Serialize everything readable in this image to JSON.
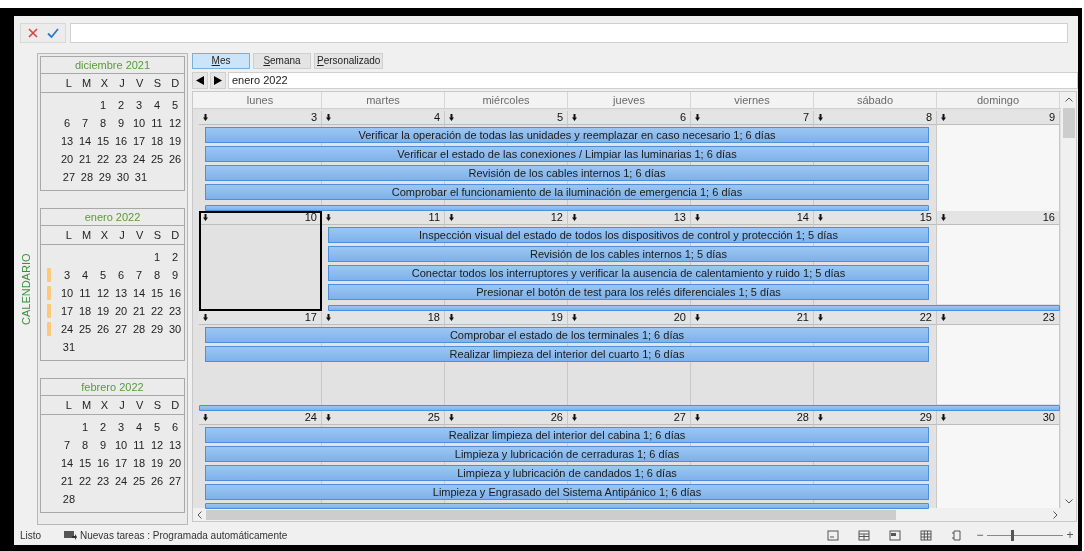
{
  "toolbar": {
    "buttons": [
      {
        "kind": "cancel"
      },
      {
        "kind": "confirm"
      }
    ]
  },
  "side_label": "CALENDARIO",
  "mini_calendars": [
    {
      "title": "diciembre 2021",
      "weekdays": [
        "L",
        "M",
        "X",
        "J",
        "V",
        "S",
        "D"
      ],
      "weeks": [
        {
          "kind": "first",
          "marked": false,
          "days": [
            "1",
            "2",
            "3",
            "4",
            "5"
          ]
        },
        {
          "kind": "full",
          "marked": false,
          "days": [
            "6",
            "7",
            "8",
            "9",
            "10",
            "11",
            "12"
          ]
        },
        {
          "kind": "full",
          "marked": false,
          "days": [
            "13",
            "14",
            "15",
            "16",
            "17",
            "18",
            "19"
          ]
        },
        {
          "kind": "full",
          "marked": false,
          "days": [
            "20",
            "21",
            "22",
            "23",
            "24",
            "25",
            "26"
          ]
        },
        {
          "kind": "last",
          "marked": false,
          "days": [
            "27",
            "28",
            "29",
            "30",
            "31"
          ]
        }
      ]
    },
    {
      "title": "enero 2022",
      "weekdays": [
        "L",
        "M",
        "X",
        "J",
        "V",
        "S",
        "D"
      ],
      "weeks": [
        {
          "kind": "first",
          "marked": false,
          "days": [
            "1",
            "2"
          ]
        },
        {
          "kind": "full",
          "marked": true,
          "days": [
            "3",
            "4",
            "5",
            "6",
            "7",
            "8",
            "9"
          ]
        },
        {
          "kind": "full",
          "marked": true,
          "days": [
            "10",
            "11",
            "12",
            "13",
            "14",
            "15",
            "16"
          ]
        },
        {
          "kind": "full",
          "marked": true,
          "days": [
            "17",
            "18",
            "19",
            "20",
            "21",
            "22",
            "23"
          ]
        },
        {
          "kind": "full",
          "marked": true,
          "days": [
            "24",
            "25",
            "26",
            "27",
            "28",
            "29",
            "30"
          ]
        },
        {
          "kind": "last",
          "marked": false,
          "days": [
            "31"
          ]
        }
      ]
    },
    {
      "title": "febrero 2022",
      "weekdays": [
        "L",
        "M",
        "X",
        "J",
        "V",
        "S",
        "D"
      ],
      "weeks": [
        {
          "kind": "first",
          "marked": false,
          "days": [
            "1",
            "2",
            "3",
            "4",
            "5",
            "6"
          ]
        },
        {
          "kind": "full",
          "marked": false,
          "days": [
            "7",
            "8",
            "9",
            "10",
            "11",
            "12",
            "13"
          ]
        },
        {
          "kind": "full",
          "marked": false,
          "days": [
            "14",
            "15",
            "16",
            "17",
            "18",
            "19",
            "20"
          ]
        },
        {
          "kind": "full",
          "marked": false,
          "days": [
            "21",
            "22",
            "23",
            "24",
            "25",
            "26",
            "27"
          ]
        },
        {
          "kind": "last",
          "marked": false,
          "days": [
            "28"
          ]
        }
      ]
    }
  ],
  "view_tabs": [
    {
      "label": "Mes",
      "selected": true
    },
    {
      "label": "Semana",
      "selected": false
    },
    {
      "label": "Personalizado",
      "selected": false
    }
  ],
  "period": "enero 2022",
  "weekday_headers": [
    "lunes",
    "martes",
    "miércoles",
    "jueves",
    "viernes",
    "sábado",
    "domingo"
  ],
  "weeks": [
    {
      "days": [
        {
          "date": "3",
          "kind": "busy",
          "selected": false
        },
        {
          "date": "4",
          "kind": "busy",
          "selected": false
        },
        {
          "date": "5",
          "kind": "busy",
          "selected": false
        },
        {
          "date": "6",
          "kind": "busy",
          "selected": false
        },
        {
          "date": "7",
          "kind": "busy",
          "selected": false
        },
        {
          "date": "8",
          "kind": "busy",
          "selected": false
        },
        {
          "date": "9",
          "kind": "free",
          "selected": false
        }
      ],
      "tasks": [
        {
          "kind": "workweek",
          "label": "Verificar la operación de todas las unidades y reemplazar en caso necesario 1; 6 días"
        },
        {
          "kind": "workweek",
          "label": "Verificar el estado de las conexiones / Limpiar las luminarias 1; 6 días"
        },
        {
          "kind": "workweek",
          "label": "Revisión de los cables internos 1; 6 días"
        },
        {
          "kind": "workweek",
          "label": "Comprobar el funcionamiento de la iluminación de emergencia 1; 6 días"
        },
        {
          "kind": "workweek"
        }
      ]
    },
    {
      "days": [
        {
          "date": "10",
          "kind": "busy",
          "selected": true
        },
        {
          "date": "11",
          "kind": "busy",
          "selected": false
        },
        {
          "date": "12",
          "kind": "busy",
          "selected": false
        },
        {
          "date": "13",
          "kind": "busy",
          "selected": false
        },
        {
          "date": "14",
          "kind": "busy",
          "selected": false
        },
        {
          "date": "15",
          "kind": "busy",
          "selected": false
        },
        {
          "date": "16",
          "kind": "free",
          "selected": false
        }
      ],
      "tasks": [
        {
          "kind": "midweek",
          "label": "Inspección visual del estado de todos los dispositivos de control y protección 1; 5 días"
        },
        {
          "kind": "midweek",
          "label": "Revisión de los cables internos 1; 5 días"
        },
        {
          "kind": "midweek",
          "label": "Conectar todos los interruptores y verificar la ausencia de calentamiento y ruido 1; 5 días"
        },
        {
          "kind": "midweek",
          "label": "Presionar el botón de test para los relés diferenciales 1; 5 días"
        },
        {
          "kind": "lateweek"
        }
      ]
    },
    {
      "days": [
        {
          "date": "17",
          "kind": "busy",
          "selected": false
        },
        {
          "date": "18",
          "kind": "busy",
          "selected": false
        },
        {
          "date": "19",
          "kind": "busy",
          "selected": false
        },
        {
          "date": "20",
          "kind": "busy",
          "selected": false
        },
        {
          "date": "21",
          "kind": "busy",
          "selected": false
        },
        {
          "date": "22",
          "kind": "busy",
          "selected": false
        },
        {
          "date": "23",
          "kind": "free",
          "selected": false
        }
      ],
      "tasks": [
        {
          "kind": "workweek",
          "label": "Comprobar el estado de los terminales 1; 6 días"
        },
        {
          "kind": "workweek",
          "label": "Realizar limpieza del interior del cuarto 1; 6 días"
        },
        {
          "kind": "fullweek"
        }
      ]
    },
    {
      "days": [
        {
          "date": "24",
          "kind": "busy",
          "selected": false
        },
        {
          "date": "25",
          "kind": "busy",
          "selected": false
        },
        {
          "date": "26",
          "kind": "busy",
          "selected": false
        },
        {
          "date": "27",
          "kind": "busy",
          "selected": false
        },
        {
          "date": "28",
          "kind": "busy",
          "selected": false
        },
        {
          "date": "29",
          "kind": "busy",
          "selected": false
        },
        {
          "date": "30",
          "kind": "free",
          "selected": false
        }
      ],
      "tasks": [
        {
          "kind": "workweek",
          "label": "Realizar limpieza del interior del cabina 1; 6 días"
        },
        {
          "kind": "workweek",
          "label": "Limpieza y lubricación de cerraduras 1; 6 días"
        },
        {
          "kind": "workweek",
          "label": "Limpieza y lubricación de candados 1; 6 días"
        },
        {
          "kind": "workweek",
          "label": "Limpieza y Engrasado del Sistema Antipánico 1; 6 días"
        },
        {
          "kind": "workweek"
        }
      ]
    }
  ],
  "status_bar": {
    "state": "Listo",
    "message": "Nuevas tareas : Programada automáticamente",
    "zoom_out": "−",
    "zoom": {
      "level": 0.33
    },
    "zoom_in": "+"
  }
}
